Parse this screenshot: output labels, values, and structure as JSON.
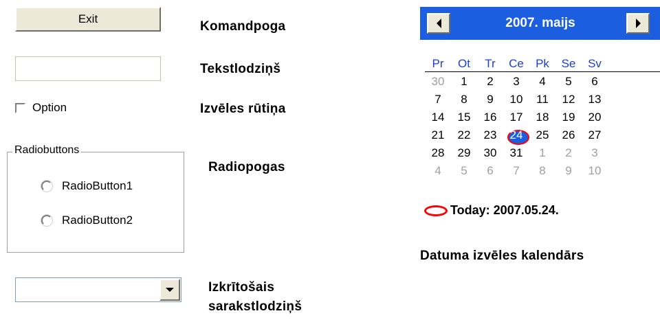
{
  "command_button": {
    "label": "Exit",
    "caption": "Komandpoga"
  },
  "text_box": {
    "value": "",
    "caption": "Tekstlodziņš"
  },
  "checkbox": {
    "label": "Option",
    "checked": false,
    "caption": "Izvēles rūtiņa"
  },
  "radio_group": {
    "title": "Radiobuttons",
    "options": [
      {
        "label": "RadioButton1",
        "selected": false
      },
      {
        "label": "RadioButton2",
        "selected": false
      }
    ],
    "caption": "Radiopogas"
  },
  "combo_box": {
    "value": "",
    "caption_line1": "Izkrītošais",
    "caption_line2": "sarakstlodziņš",
    "arrow_icon": "chevron-down-icon"
  },
  "calendar": {
    "title": "2007. maijs",
    "prev_icon": "arrow-left-icon",
    "next_icon": "arrow-right-icon",
    "weekdays": [
      "Pr",
      "Ot",
      "Tr",
      "Ce",
      "Pk",
      "Se",
      "Sv"
    ],
    "weeks": [
      [
        "30",
        "1",
        "2",
        "3",
        "4",
        "5",
        "6"
      ],
      [
        "7",
        "8",
        "9",
        "10",
        "11",
        "12",
        "13"
      ],
      [
        "14",
        "15",
        "16",
        "17",
        "18",
        "19",
        "20"
      ],
      [
        "21",
        "22",
        "23",
        "24",
        "25",
        "26",
        "27"
      ],
      [
        "28",
        "29",
        "30",
        "31",
        "1",
        "2",
        "3"
      ],
      [
        "4",
        "5",
        "6",
        "7",
        "8",
        "9",
        "10"
      ]
    ],
    "selected_day": "24",
    "today_label": "Today: 2007.05.24.",
    "caption": "Datuma izvēles kalendārs",
    "header_color": "#1b5fe0",
    "marker_color": "#ff0000"
  }
}
